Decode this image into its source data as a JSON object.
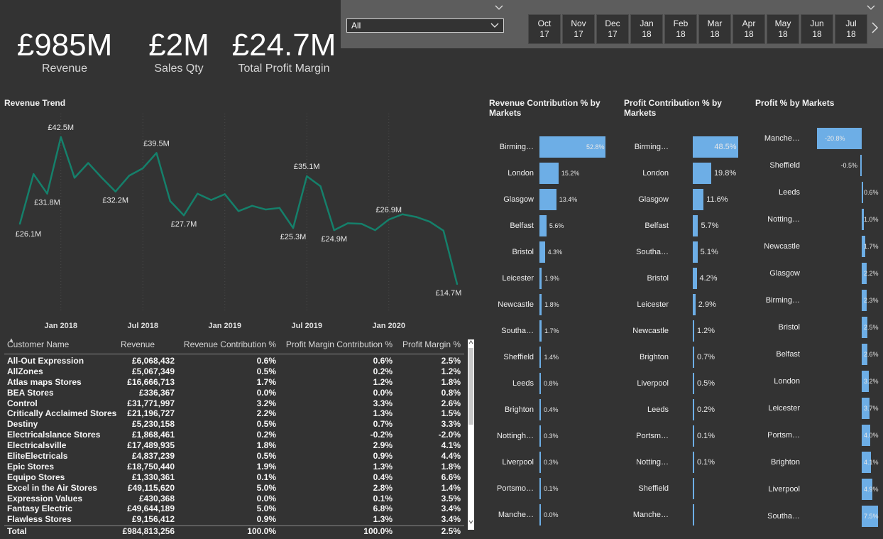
{
  "kpis": [
    {
      "value": "£985M",
      "label": "Revenue"
    },
    {
      "value": "£2M",
      "label": "Sales Qty"
    },
    {
      "value": "£24.7M",
      "label": "Total Profit Margin"
    }
  ],
  "slicer": {
    "dropdown_value": "All",
    "months": [
      {
        "m": "Oct",
        "y": "17"
      },
      {
        "m": "Nov",
        "y": "17"
      },
      {
        "m": "Dec",
        "y": "17"
      },
      {
        "m": "Jan",
        "y": "18"
      },
      {
        "m": "Feb",
        "y": "18"
      },
      {
        "m": "Mar",
        "y": "18"
      },
      {
        "m": "Apr",
        "y": "18"
      },
      {
        "m": "May",
        "y": "18"
      },
      {
        "m": "Jun",
        "y": "18"
      },
      {
        "m": "Jul",
        "y": "18"
      }
    ]
  },
  "colors": {
    "line": "#15806b",
    "bar": "#6daee6",
    "background": "#333333"
  },
  "chart_data": [
    {
      "type": "line",
      "title": "Revenue Trend",
      "x_ticks": [
        "Jan 2018",
        "Jul 2018",
        "Jan 2019",
        "Jul 2019",
        "Jan 2020"
      ],
      "x": [
        "2017-10",
        "2017-11",
        "2017-12",
        "2018-01",
        "2018-02",
        "2018-03",
        "2018-04",
        "2018-05",
        "2018-06",
        "2018-07",
        "2018-08",
        "2018-09",
        "2018-10",
        "2018-11",
        "2018-12",
        "2019-01",
        "2019-02",
        "2019-03",
        "2019-04",
        "2019-05",
        "2019-06",
        "2019-07",
        "2019-08",
        "2019-09",
        "2019-10",
        "2019-11",
        "2019-12",
        "2020-01",
        "2020-02",
        "2020-03",
        "2020-04",
        "2020-05",
        "2020-06"
      ],
      "values": [
        26.1,
        35.5,
        31.8,
        42.5,
        34.8,
        37.6,
        34.8,
        32.2,
        35.2,
        36.6,
        39.5,
        30.4,
        27.7,
        31.8,
        30.6,
        31.7,
        28.5,
        29.5,
        28.8,
        29.1,
        25.3,
        35.1,
        33.2,
        24.9,
        26.2,
        26.1,
        24.9,
        26.9,
        27.9,
        27.4,
        26.5,
        24.8,
        14.7
      ],
      "data_labels": [
        {
          "index": 0,
          "text": "£26.1M"
        },
        {
          "index": 2,
          "text": "£31.8M"
        },
        {
          "index": 3,
          "text": "£42.5M"
        },
        {
          "index": 7,
          "text": "£32.2M"
        },
        {
          "index": 10,
          "text": "£39.5M"
        },
        {
          "index": 12,
          "text": "£27.7M"
        },
        {
          "index": 20,
          "text": "£25.3M"
        },
        {
          "index": 21,
          "text": "£35.1M"
        },
        {
          "index": 23,
          "text": "£24.9M"
        },
        {
          "index": 27,
          "text": "£26.9M"
        },
        {
          "index": 32,
          "text": "£14.7M"
        }
      ],
      "units": "£M"
    },
    {
      "type": "bar",
      "title": "Revenue Contribution % by Markets",
      "categories": [
        "Birming…",
        "London",
        "Glasgow",
        "Belfast",
        "Bristol",
        "Leicester",
        "Newcastle",
        "Southa…",
        "Sheffield",
        "Leeds",
        "Brighton",
        "Nottingh…",
        "Liverpool",
        "Portsmo…",
        "Manche…"
      ],
      "values": [
        52.8,
        15.2,
        13.4,
        5.6,
        4.3,
        1.9,
        1.8,
        1.7,
        1.4,
        0.8,
        0.4,
        0.3,
        0.3,
        0.1,
        0.0
      ],
      "labels": [
        "52.8%",
        "15.2%",
        "13.4%",
        "5.6%",
        "4.3%",
        "1.9%",
        "1.8%",
        "1.7%",
        "1.4%",
        "0.8%",
        "0.4%",
        "0.3%",
        "0.3%",
        "0.1%",
        "0.0%"
      ]
    },
    {
      "type": "bar",
      "title": "Profit Contribution % by Markets",
      "categories": [
        "Birming…",
        "London",
        "Glasgow",
        "Belfast",
        "Southa…",
        "Bristol",
        "Leicester",
        "Newcastle",
        "Brighton",
        "Liverpool",
        "Leeds",
        "Portsm…",
        "Notting…",
        "Sheffield",
        "Manche…"
      ],
      "values": [
        48.5,
        19.8,
        11.6,
        5.7,
        5.1,
        4.2,
        2.9,
        1.2,
        0.7,
        0.5,
        0.2,
        0.1,
        0.1,
        0,
        0
      ],
      "labels": [
        "48.5%",
        "19.8%",
        "11.6%",
        "5.7%",
        "5.1%",
        "4.2%",
        "2.9%",
        "1.2%",
        "0.7%",
        "0.5%",
        "0.2%",
        "0.1%",
        "0.1%",
        "",
        ""
      ]
    },
    {
      "type": "bar",
      "title": "Profit % by Markets",
      "categories": [
        "Manche…",
        "Sheffield",
        "Leeds",
        "Notting…",
        "Newcastle",
        "Glasgow",
        "Birming…",
        "Bristol",
        "Belfast",
        "London",
        "Leicester",
        "Portsm…",
        "Brighton",
        "Liverpool",
        "Southa…"
      ],
      "values": [
        -20.8,
        -0.5,
        0.6,
        1.0,
        1.7,
        2.2,
        2.3,
        2.5,
        2.6,
        3.2,
        3.7,
        4.0,
        4.1,
        4.9,
        7.5
      ],
      "labels": [
        "-20.8%",
        "-0.5%",
        "0.6%",
        "1.0%",
        "1.7%",
        "2.2%",
        "2.3%",
        "2.5%",
        "2.6%",
        "3.2%",
        "3.7%",
        "4.0%",
        "4.1%",
        "4.9%",
        "7.5%"
      ]
    }
  ],
  "table": {
    "columns": [
      "Customer Name",
      "Revenue",
      "Revenue Contribution %",
      "Profit Margin Contribution %",
      "Profit Margin %"
    ],
    "rows": [
      [
        "All-Out Expression",
        "£6,068,432",
        "0.6%",
        "0.6%",
        "2.5%"
      ],
      [
        "AllZones",
        "£5,067,349",
        "0.5%",
        "0.2%",
        "1.2%"
      ],
      [
        "Atlas maps Stores",
        "£16,666,713",
        "1.7%",
        "1.2%",
        "1.8%"
      ],
      [
        "BEA Stores",
        "£336,367",
        "0.0%",
        "0.0%",
        "0.8%"
      ],
      [
        "Control",
        "£31,771,997",
        "3.2%",
        "3.3%",
        "2.6%"
      ],
      [
        "Critically Acclaimed Stores",
        "£21,196,727",
        "2.2%",
        "1.3%",
        "1.5%"
      ],
      [
        "Destiny",
        "£5,230,158",
        "0.5%",
        "0.7%",
        "3.3%"
      ],
      [
        "Electricalslance Stores",
        "£1,868,461",
        "0.2%",
        "-0.2%",
        "-2.0%"
      ],
      [
        "Electricalsville",
        "£17,489,935",
        "1.8%",
        "2.9%",
        "4.1%"
      ],
      [
        "EliteElectricals",
        "£4,837,239",
        "0.5%",
        "0.9%",
        "4.4%"
      ],
      [
        "Epic Stores",
        "£18,750,440",
        "1.9%",
        "1.3%",
        "1.8%"
      ],
      [
        "Equipo Stores",
        "£1,330,361",
        "0.1%",
        "0.4%",
        "6.6%"
      ],
      [
        "Excel in the Air Stores",
        "£49,115,620",
        "5.0%",
        "2.8%",
        "1.4%"
      ],
      [
        "Expression Values",
        "£430,368",
        "0.0%",
        "0.1%",
        "3.5%"
      ],
      [
        "Fantasy Electric",
        "£49,644,189",
        "5.0%",
        "6.8%",
        "3.4%"
      ],
      [
        "Flawless Stores",
        "£9,156,412",
        "0.9%",
        "1.3%",
        "3.4%"
      ]
    ],
    "total": [
      "Total",
      "£984,813,256",
      "100.0%",
      "100.0%",
      "2.5%"
    ]
  }
}
